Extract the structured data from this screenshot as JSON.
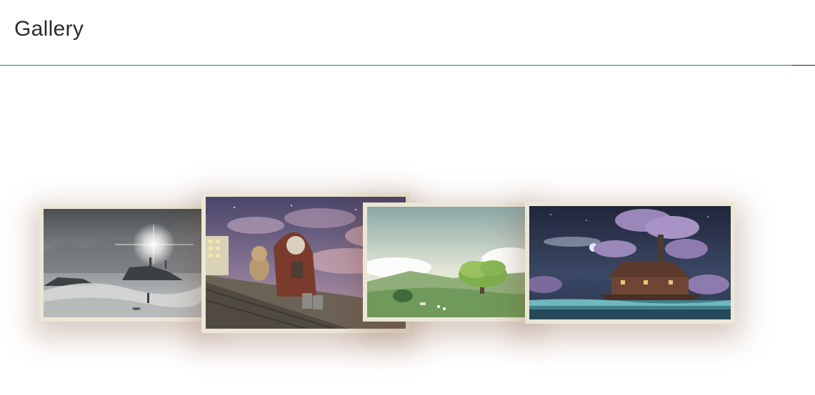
{
  "header": {
    "title": "Gallery",
    "accent_color": "#2f7f76"
  },
  "gallery": {
    "frame_color": "#ece6d6",
    "images": [
      {
        "name": "misty-ships-image"
      },
      {
        "name": "hooded-girl-rooftop-image"
      },
      {
        "name": "green-valley-tree-image"
      },
      {
        "name": "cherry-blossom-house-image"
      }
    ]
  }
}
